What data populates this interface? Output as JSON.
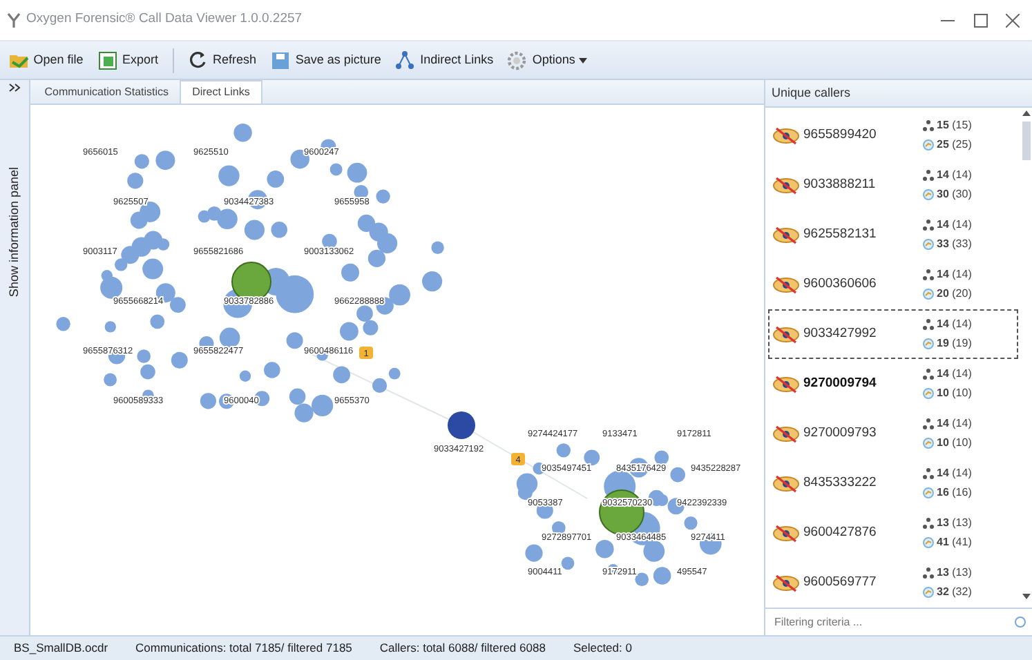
{
  "window": {
    "title": "Oxygen Forensic® Call Data Viewer 1.0.0.2257"
  },
  "toolbar": [
    {
      "label": "Open file",
      "kind": "folder"
    },
    {
      "label": "Export",
      "kind": "export"
    },
    {
      "label": "Refresh",
      "kind": "refresh"
    },
    {
      "label": "Save as picture",
      "kind": "save"
    },
    {
      "label": "Indirect Links",
      "kind": "network"
    },
    {
      "label": "Options",
      "kind": "gear"
    }
  ],
  "side_strip": {
    "label": "Show information panel"
  },
  "tabs": [
    {
      "label": "Communication Statistics",
      "selected": false
    },
    {
      "label": "Direct Links",
      "selected": true
    }
  ],
  "graph": {
    "clusters": [
      {
        "labels": [
          "9656015",
          "9625510",
          "9600247",
          "9625507",
          "9034427383",
          "9655958",
          "9003117",
          "9655821686",
          "9003133062",
          "9655668214",
          "9033782886",
          "9662288888",
          "9655876312",
          "9655822477",
          "9600486116",
          "9600589333",
          "9600040",
          "9655370"
        ],
        "badge": "1"
      },
      {
        "labels": [
          "9274424177",
          "9133471",
          "9172811",
          "9035497451",
          "8435176429",
          "9435228287",
          "9053387",
          "9032570230",
          "9422392339",
          "9272897701",
          "9033464485",
          "9274411",
          "9004411",
          "9172911",
          "495547"
        ],
        "badge": "4"
      }
    ],
    "lone_node": {
      "label": "9033427192"
    }
  },
  "unique_callers": {
    "title": "Unique callers",
    "rows": [
      {
        "number": "9655899420",
        "links": "15",
        "links_total": "(15)",
        "calls": "25",
        "calls_total": "(25)",
        "selected": false,
        "bold": false
      },
      {
        "number": "9033888211",
        "links": "14",
        "links_total": "(14)",
        "calls": "30",
        "calls_total": "(30)",
        "selected": false,
        "bold": false
      },
      {
        "number": "9625582131",
        "links": "14",
        "links_total": "(14)",
        "calls": "33",
        "calls_total": "(33)",
        "selected": false,
        "bold": false
      },
      {
        "number": "9600360606",
        "links": "14",
        "links_total": "(14)",
        "calls": "20",
        "calls_total": "(20)",
        "selected": false,
        "bold": false
      },
      {
        "number": "9033427992",
        "links": "14",
        "links_total": "(14)",
        "calls": "19",
        "calls_total": "(19)",
        "selected": true,
        "bold": false
      },
      {
        "number": "9270009794",
        "links": "14",
        "links_total": "(14)",
        "calls": "10",
        "calls_total": "(10)",
        "selected": false,
        "bold": true
      },
      {
        "number": "9270009793",
        "links": "14",
        "links_total": "(14)",
        "calls": "10",
        "calls_total": "(10)",
        "selected": false,
        "bold": false
      },
      {
        "number": "8435333222",
        "links": "14",
        "links_total": "(14)",
        "calls": "16",
        "calls_total": "(16)",
        "selected": false,
        "bold": false
      },
      {
        "number": "9600427876",
        "links": "13",
        "links_total": "(13)",
        "calls": "41",
        "calls_total": "(41)",
        "selected": false,
        "bold": false
      },
      {
        "number": "9600569777",
        "links": "13",
        "links_total": "(13)",
        "calls": "32",
        "calls_total": "(32)",
        "selected": false,
        "bold": false
      }
    ],
    "filter": {
      "placeholder": "Filtering criteria ..."
    }
  },
  "status_bar": [
    "BS_SmallDB.ocdr",
    "Communications: total 7185/ filtered 7185",
    "Callers: total 6088/ filtered 6088",
    "Selected: 0"
  ]
}
